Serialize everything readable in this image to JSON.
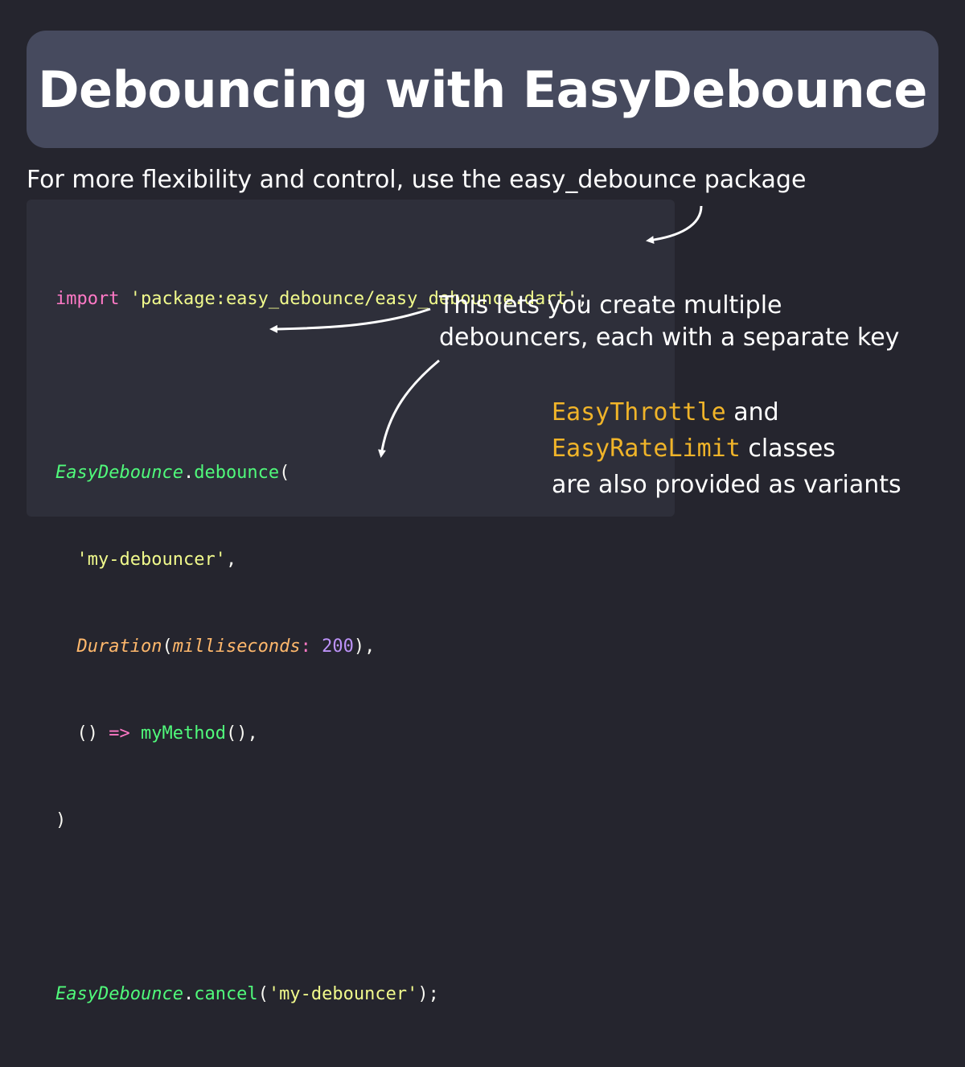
{
  "title": "Debouncing with EasyDebounce",
  "subtitle": "For more flexibility and control, use the easy_debounce package",
  "code": {
    "line1": {
      "kw": "import",
      "str": "'package:easy_debounce/easy_debounce.dart'",
      "end": ";"
    },
    "line3": {
      "cls": "EasyDebounce",
      "dot": ".",
      "fn": "debounce",
      "open": "("
    },
    "line4": {
      "str": "'my-debouncer'",
      "end": ","
    },
    "line5": {
      "typ": "Duration",
      "open": "(",
      "param": "milliseconds",
      "colon": ": ",
      "num": "200",
      "end": "),"
    },
    "line6": {
      "parens": "() ",
      "arrow": "=>",
      "fn": "myMethod",
      "end": "(),"
    },
    "line7": {
      "close": ")"
    },
    "line9": {
      "cls": "EasyDebounce",
      "dot": ".",
      "fn": "cancel",
      "open": "(",
      "str": "'my-debouncer'",
      "end": ");"
    }
  },
  "callout": {
    "line1": "This lets you create multiple",
    "line2": "debouncers, each with a separate key"
  },
  "variants": {
    "class1": "EasyThrottle",
    "text1": " and",
    "class2": "EasyRateLimit",
    "text2": " classes",
    "line3": "are also provided as variants"
  },
  "colors": {
    "background": "#25252e",
    "title_bar": "#464a5e",
    "code_panel": "#2e2f3a",
    "accent_class": "#f0b429"
  }
}
